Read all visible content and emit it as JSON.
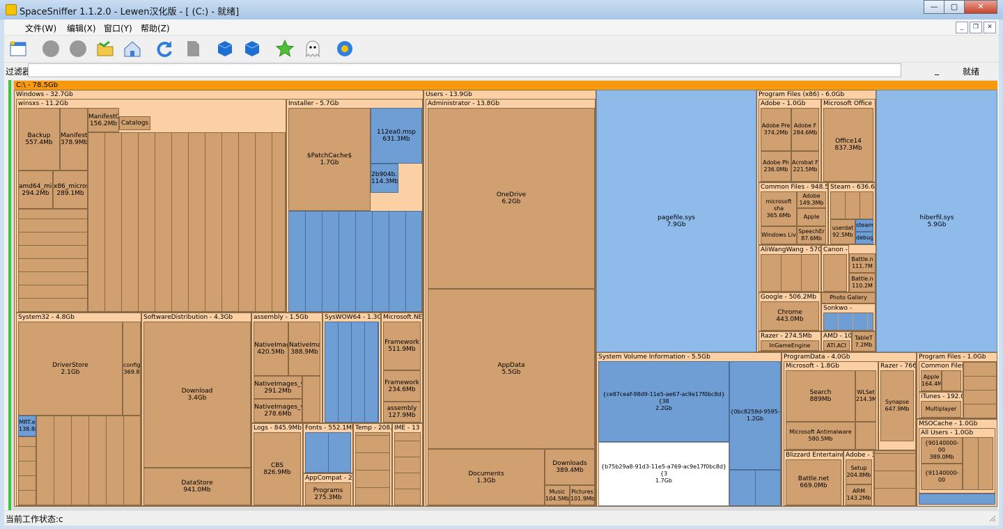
{
  "window": {
    "title": "SpaceSniffer 1.1.2.0 - Lewen汉化版 - [ (C:) - 就绪]"
  },
  "menu": [
    "文件(W)",
    "编辑(X)",
    "窗口(Y)",
    "帮助(Z)"
  ],
  "toolbar_icons": [
    "new-scan-window-icon",
    "circle-icon",
    "circle-icon",
    "folder-icon",
    "home-icon",
    "refresh-icon",
    "document-icon",
    "cube-icon",
    "cube-icon",
    "star-icon",
    "ghost-icon",
    "gear-icon"
  ],
  "filter": {
    "label": "过滤器",
    "value": "",
    "tail": "_",
    "status": "就绪"
  },
  "root": {
    "label": "C:\\ - 78.5Gb"
  },
  "status": {
    "text": "当前工作状态:c"
  },
  "folders": {
    "windows": "Windows - 32.7Gb",
    "winsxs": "winsxs - 11.2Gb",
    "installer": "Installer - 5.7Gb",
    "users": "Users - 13.9Gb",
    "administrator": "Administrator - 13.8Gb",
    "pf86": "Program Files (x86) - 6.0Gb",
    "adobe": "Adobe - 1.0Gb",
    "msoffice": "Microsoft Office - 9",
    "common": "Common Files - 948.5M",
    "steam": "Steam - 636.6M",
    "aliwangwang": "AliWangWang - 570.7",
    "canon": "Canon - 2",
    "google": "Google - 506.2Mb",
    "sonkwo": "Sonkwo -",
    "razer": "Razer - 274.5Mb",
    "amd": "AMD - 10",
    "system32": "System32 - 4.8Gb",
    "softdist": "SoftwareDistribution - 4.3Gb",
    "assembly": "assembly - 1.5Gb",
    "syswow": "SysWOW64 - 1.3Gb",
    "microsoftnet": "Microsoft.NE",
    "logs": "Logs - 845.9Mb",
    "fonts": "Fonts - 552.1Mb",
    "temp": "Temp - 208.6",
    "ime": "IME - 13",
    "appcompat": "AppCompat - 2",
    "svi": "System Volume Information - 5.5Gb",
    "programdata": "ProgramData - 4.0Gb",
    "msdata": "Microsoft - 1.8Gb",
    "razer2": "Razer - 766.",
    "blizzard": "Blizzard Entertainme",
    "adobe3": "Adobe - 3",
    "pf": "Program Files - 1.0Gb",
    "commonfiles2": "Common Files",
    "itunes": "iTunes - 192.0",
    "msocache": "MSOCache - 1.0Gb",
    "allusers": "All Users - 1.0Gb"
  },
  "files": {
    "backup": "Backup\n557.4Mb",
    "manifests": "Manifests\n378.9Mb",
    "manifestc": "ManifestC\n156.2Mb",
    "amd64mic": "amd64_mic\n294.2Mb",
    "x86micros": "x86_micros\n289.1Mb",
    "catalogs": "Catalogs",
    "patchcache": "$PatchCache$\n1.7Gb",
    "msp": "112ea0.msp\n631.3Mb",
    "b2904": "2b904b.m\n114.3Mb",
    "onedrive": "OneDrive\n6.2Gb",
    "appdata": "AppData\n5.5Gb",
    "documents": "Documents\n1.3Gb",
    "downloads": "Downloads\n389.4Mb",
    "music": "Music\n104.5Mb",
    "pictures": "Pictures\n101.9Mb",
    "pagefile": "pagefile.sys\n7.9Gb",
    "hiberfil": "hiberfil.sys\n5.9Gb",
    "adobepre": "Adobe Pre\n374.2Mb",
    "adobef": "Adobe F\n284.6Mb",
    "adobeph": "Adobe Ph\n236.0Mb",
    "acrobat": "Acrobat F\n221.5Mb",
    "office14": "Office14\n837.3Mb",
    "msshared": "microsoft sha\n365.6Mb",
    "adobe149": "Adobe\n149.3Mb",
    "apple": "Apple",
    "winlive": "Windows Liv",
    "speechen": "SpeechEr\n87.6Mb",
    "chrome": "Chrome\n443.0Mb",
    "ingame": "InGameEngine",
    "driverstore": "DriverStore\n2.1Gb",
    "config": "config\n369.8",
    "download": "Download\n3.4Gb",
    "datastore": "DataStore\n941.0Mb",
    "nativeimag1": "NativeImag\n420.5Mb",
    "nativeimag2": "NativeIma\n388.9Mb",
    "nativeimages3": "NativeImages_v\n291.2Mb",
    "nativeimages4": "NativeImages_v\n278.6Mb",
    "framework1": "Framework\n511.9Mb",
    "framework2": "Framework\n234.6Mb",
    "assembly2": "assembly\n127.9Mb",
    "cbs": "CBS\n826.9Mb",
    "programs": "Programs\n275.3Mb",
    "svi1": "{ce87ceaf-98d9-11e5-ae67-ac9e17f0bc8d}{38\n2.2Gb",
    "svi2": "{b75b29a8-91d3-11e5-a769-ac9e17f0bc8d}{3\n1.7Gb",
    "svi3": "{0bc8259d-9595-\n1.2Gb",
    "search": "Search\n889Mb",
    "wlset": "WLSet\n214.3M",
    "antimalware": "Microsoft Antimalware\n580.5Mb",
    "synapse": "Synapse\n647.9Mb",
    "battlenet": "Battle.net\n669.0Mb",
    "setup": "Setup\n204.8Mb",
    "arm": "ARM\n143.2Mb",
    "apple2": "Apple\n164.4M",
    "multiplayer": "Multiplayer",
    "m9014a": "{90140000-00\n389.0Mb",
    "m9114": "{91140000-00",
    "battle111": "Battle.n\n111.7M",
    "battle110": "Battle.n\n110.2M",
    "photo": "Photo Gallery",
    "steamdir": "steam",
    "debug": "debug.",
    "userdat": "userdat\n92.5Mb",
    "mrt": "MRT.e\n138.8M",
    "ati": "ATI.ACI",
    "tablet": "TableT\n7.2Mb"
  }
}
